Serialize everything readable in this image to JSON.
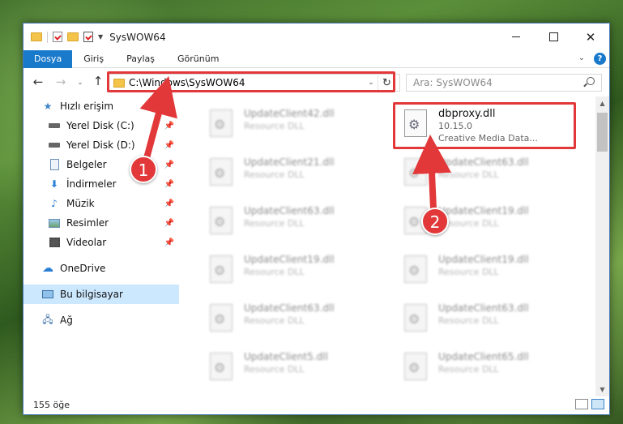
{
  "window": {
    "title": "SysWOW64"
  },
  "ribbon": {
    "tabs": [
      "Dosya",
      "Giriş",
      "Paylaş",
      "Görünüm"
    ],
    "help": "?"
  },
  "address": {
    "path": "C:\\Windows\\SysWOW64",
    "search_placeholder": "Ara: SysWOW64"
  },
  "sidebar": {
    "items": [
      {
        "label": "Hızlı erişim",
        "icon": "star-icon"
      },
      {
        "label": "Yerel Disk (C:)",
        "icon": "drive-icon"
      },
      {
        "label": "Yerel Disk (D:)",
        "icon": "drive-icon"
      },
      {
        "label": "Belgeler",
        "icon": "documents-icon"
      },
      {
        "label": "İndirmeler",
        "icon": "download-icon"
      },
      {
        "label": "Müzik",
        "icon": "music-icon"
      },
      {
        "label": "Resimler",
        "icon": "pictures-icon"
      },
      {
        "label": "Videolar",
        "icon": "videos-icon"
      },
      {
        "label": "OneDrive",
        "icon": "cloud-icon"
      },
      {
        "label": "Bu bilgisayar",
        "icon": "computer-icon"
      },
      {
        "label": "Ağ",
        "icon": "network-icon"
      }
    ]
  },
  "files": {
    "main": {
      "name": "dbproxy.dll",
      "version": "10.15.0",
      "desc": "Creative Media Data..."
    },
    "left": [
      {
        "name": "UpdateClient42.dll",
        "type": "Resource DLL"
      },
      {
        "name": "UpdateClient21.dll",
        "type": "Resource DLL"
      },
      {
        "name": "UpdateClient63.dll",
        "type": "Resource DLL"
      },
      {
        "name": "UpdateClient19.dll",
        "type": "Resource DLL"
      },
      {
        "name": "UpdateClient63.dll",
        "type": "Resource DLL"
      },
      {
        "name": "UpdateClient5.dll",
        "type": "Resource DLL"
      }
    ],
    "right": [
      {
        "name": "UpdateClient63.dll",
        "type": "Resource DLL"
      },
      {
        "name": "UpdateClient19.dll",
        "type": "Resource DLL"
      },
      {
        "name": "UpdateClient19.dll",
        "type": "Resource DLL"
      },
      {
        "name": "UpdateClient63.dll",
        "type": "Resource DLL"
      },
      {
        "name": "UpdateClient65.dll",
        "type": "Resource DLL"
      }
    ]
  },
  "status": {
    "count": "155 öğe"
  },
  "annotations": {
    "badge1": "1",
    "badge2": "2",
    "color": "#e2383a"
  }
}
